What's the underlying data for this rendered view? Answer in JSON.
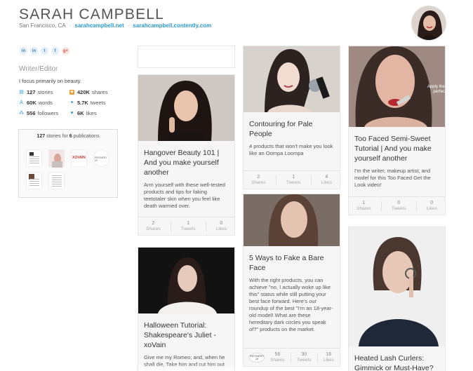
{
  "profile": {
    "name": "SARAH CAMPBELL",
    "location": "San Francisco, CA",
    "link1": "sarahcampbell.net",
    "link2": "sarahcampbell.contently.com",
    "role": "Writer/Editor",
    "bio": "I focus primarily on beauty."
  },
  "social": [
    {
      "icon": "linkedin-icon",
      "glyph": "in"
    },
    {
      "icon": "linkedin-icon",
      "glyph": "in"
    },
    {
      "icon": "twitter-icon",
      "glyph": "t"
    },
    {
      "icon": "facebook-icon",
      "glyph": "f"
    },
    {
      "icon": "google-plus-icon",
      "glyph": "g+"
    }
  ],
  "stats": {
    "stories_num": "127",
    "stories_label": "stories",
    "shares_num": "420K",
    "shares_label": "shares",
    "words_num": "60K",
    "words_label": "words",
    "tweets_num": "5.7K",
    "tweets_label": "tweets",
    "followers_num": "556",
    "followers_label": "followers",
    "likes_num": "6K",
    "likes_label": "likes"
  },
  "publications": {
    "count_stories": "127",
    "mid_text": "stories for",
    "count_pubs": "6",
    "suffix": "publications",
    "logos": {
      "style": "XOVAIN",
      "refinery": "REFINERY 29"
    }
  },
  "cards": [
    {
      "title": "Hangover Beauty 101 | And you make yourself another",
      "desc": "Arm yourself with these well-tested products and tips for faking teetotaler skin when you feel like death warmed over.",
      "shares": "2",
      "tweets": "1",
      "likes": "0"
    },
    {
      "title": "Halloween Tutorial: Shakespeare's Juliet - xoVain",
      "desc": "Give me my Romeo; and, when he shall die, Take him and cut him out in"
    },
    {
      "title": "Contouring for Pale People",
      "desc": "4 products that won't make you look like an Oompa Loompa",
      "shares": "2",
      "tweets": "1",
      "likes": "4"
    },
    {
      "title": "5 Ways to Fake a Bare Face",
      "desc": "With the right products, you can achieve \"no, I actually woke up like this\" status while still putting your best face forward. Here's our roundup of the best \"I'm an 18-year-old model! What are these hereditary dark circles you speak of?\" products on the market.",
      "shares": "56",
      "tweets": "30",
      "likes": "16"
    },
    {
      "title": "Too Faced Semi-Sweet Tutorial | And you make yourself another",
      "desc": "I'm the writer, makeup artist, and model for this Too Faced Get the Look video!",
      "shares": "1",
      "tweets": "0",
      "likes": "0",
      "overlay": "Apply the perfec"
    },
    {
      "title": "Heated Lash Curlers: Gimmick or Must-Have?"
    }
  ],
  "labels": {
    "shares": "Shares",
    "tweets": "Tweets",
    "likes": "Likes"
  },
  "colors": {
    "accent": "#2a9bd3",
    "card_bg": "#f6f6f6"
  }
}
